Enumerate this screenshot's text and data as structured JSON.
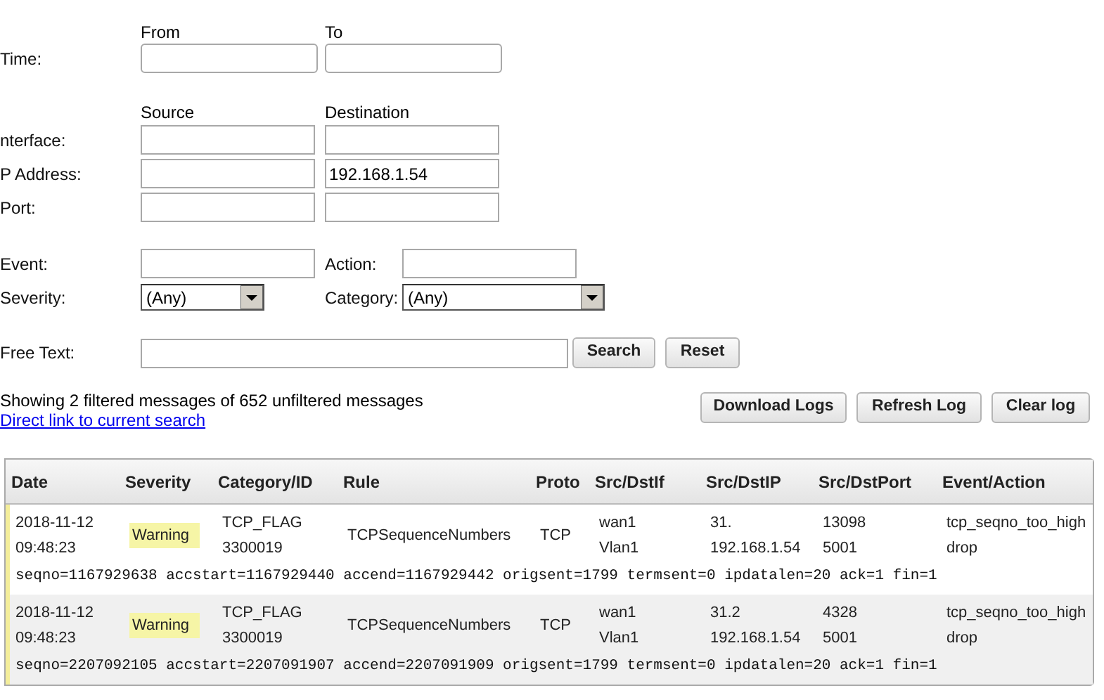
{
  "time": {
    "label": "Time:",
    "from_label": "From",
    "to_label": "To"
  },
  "address_headers": {
    "source": "Source",
    "destination": "Destination"
  },
  "address_rows": [
    {
      "label": "nterface:"
    },
    {
      "label": "P Address:",
      "destination": "192.168.1.54"
    },
    {
      "label": "Port:"
    }
  ],
  "event": {
    "label": "Event:"
  },
  "action": {
    "label": "Action:"
  },
  "severity": {
    "label": "Severity:",
    "value": "(Any)"
  },
  "category": {
    "label": "Category:",
    "value": "(Any)"
  },
  "free_text": {
    "label": "Free Text:"
  },
  "search_buttons": [
    "Search",
    "Reset"
  ],
  "summary": "Showing 2 filtered messages of 652 unfiltered messages",
  "direct_link": "Direct link to current search",
  "log_buttons": [
    "Download Logs",
    "Refresh Log",
    "Clear log"
  ],
  "table": {
    "columns": [
      "Date",
      "Severity",
      "Category/ID",
      "Rule",
      "Proto",
      "Src/DstIf",
      "Src/DstIP",
      "Src/DstPort",
      "Event/Action"
    ],
    "rows": [
      {
        "date": "2018-11-12",
        "time": "09:48:23",
        "severity": "Warning",
        "category": "TCP_FLAG",
        "id": "3300019",
        "rule": "TCPSequenceNumbers",
        "proto": "TCP",
        "src_if": "wan1",
        "dst_if": "Vlan1",
        "src_ip": "31.",
        "dst_ip": "192.168.1.54",
        "src_port": "13098",
        "dst_port": "5001",
        "event": "tcp_seqno_too_high",
        "action": "drop",
        "details": "seqno=1167929638 accstart=1167929440 accend=1167929442 origsent=1799 termsent=0 ipdatalen=20 ack=1 fin=1"
      },
      {
        "date": "2018-11-12",
        "time": "09:48:23",
        "severity": "Warning",
        "category": "TCP_FLAG",
        "id": "3300019",
        "rule": "TCPSequenceNumbers",
        "proto": "TCP",
        "src_if": "wan1",
        "dst_if": "Vlan1",
        "src_ip": "31.2",
        "dst_ip": "192.168.1.54",
        "src_port": "4328",
        "dst_port": "5001",
        "event": "tcp_seqno_too_high",
        "action": "drop",
        "details": "seqno=2207092105 accstart=2207091907 accend=2207091909 origsent=1799 termsent=0 ipdatalen=20 ack=1 fin=1"
      }
    ]
  }
}
